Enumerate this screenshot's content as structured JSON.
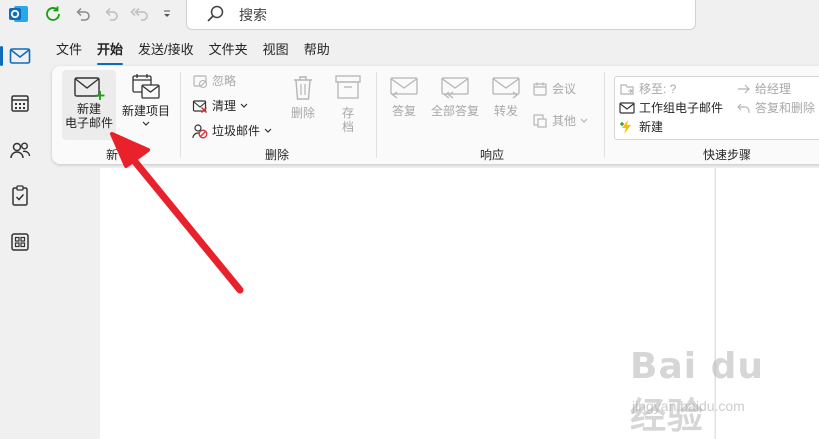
{
  "search": {
    "placeholder": "搜索"
  },
  "tabs": [
    {
      "label": "文件"
    },
    {
      "label": "开始",
      "active": true
    },
    {
      "label": "发送/接收"
    },
    {
      "label": "文件夹"
    },
    {
      "label": "视图"
    },
    {
      "label": "帮助"
    }
  ],
  "groups": {
    "new": {
      "label": "新",
      "new_email": {
        "line1": "新建",
        "line2": "电子邮件"
      },
      "new_item": {
        "label": "新建项目"
      }
    },
    "delete": {
      "label": "删除",
      "ignore": "忽略",
      "clean": "清理",
      "junk": "垃圾邮件",
      "delete_btn": "删除",
      "archive": {
        "line1": "存",
        "line2": "档"
      }
    },
    "respond": {
      "label": "响应",
      "reply": "答复",
      "reply_all": "全部答复",
      "forward": "转发",
      "meeting": "会议",
      "more": "其他"
    },
    "quicksteps": {
      "label": "快速步骤",
      "move_to": "移至: ?",
      "to_manager": "给经理",
      "team_email": "工作组电子邮件",
      "reply_delete": "答复和删除",
      "create_new": "新建"
    }
  },
  "watermark": {
    "brand": "Bai du 经验",
    "url": "jingyan.baidu.com"
  },
  "colors": {
    "accent": "#0f6cbd",
    "annotation_arrow": "#e8212b",
    "outlook_blue": "#0f6cbd"
  }
}
